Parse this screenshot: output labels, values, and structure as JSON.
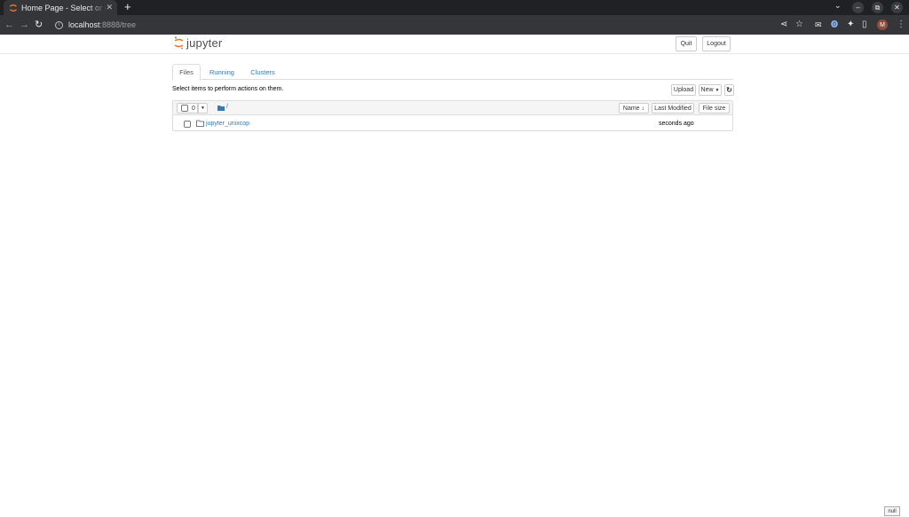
{
  "browser": {
    "tab_title": "Home Page - Select or create a notebook",
    "tab_close": "✕",
    "new_tab": "+",
    "url_host": "localhost",
    "url_rest": ":8888/tree",
    "avatar_letter": "M",
    "window_buttons": [
      "–",
      "⧉",
      "✕"
    ]
  },
  "header": {
    "logo_text": "jupyter",
    "quit_label": "Quit",
    "logout_label": "Logout"
  },
  "tabs": [
    {
      "label": "Files",
      "active": true
    },
    {
      "label": "Running",
      "active": false
    },
    {
      "label": "Clusters",
      "active": false
    }
  ],
  "files_view": {
    "hint": "Select items to perform actions on them.",
    "upload_label": "Upload",
    "new_label": "New",
    "refresh_icon": "↻",
    "selected_count": "0",
    "breadcrumb_path": "/",
    "sort_name_label": "Name",
    "sort_arrow": "🡣",
    "last_modified_label": "Last Modified",
    "file_size_label": "File size",
    "items": [
      {
        "name": "jupyter_unixcop",
        "type": "folder",
        "modified": "seconds ago"
      }
    ]
  },
  "status_badge": "null",
  "colors": {
    "link": "#337ab7",
    "jupyter_orange": "#f37726",
    "chrome_dark": "#202124",
    "chrome_toolbar": "#35363a"
  }
}
